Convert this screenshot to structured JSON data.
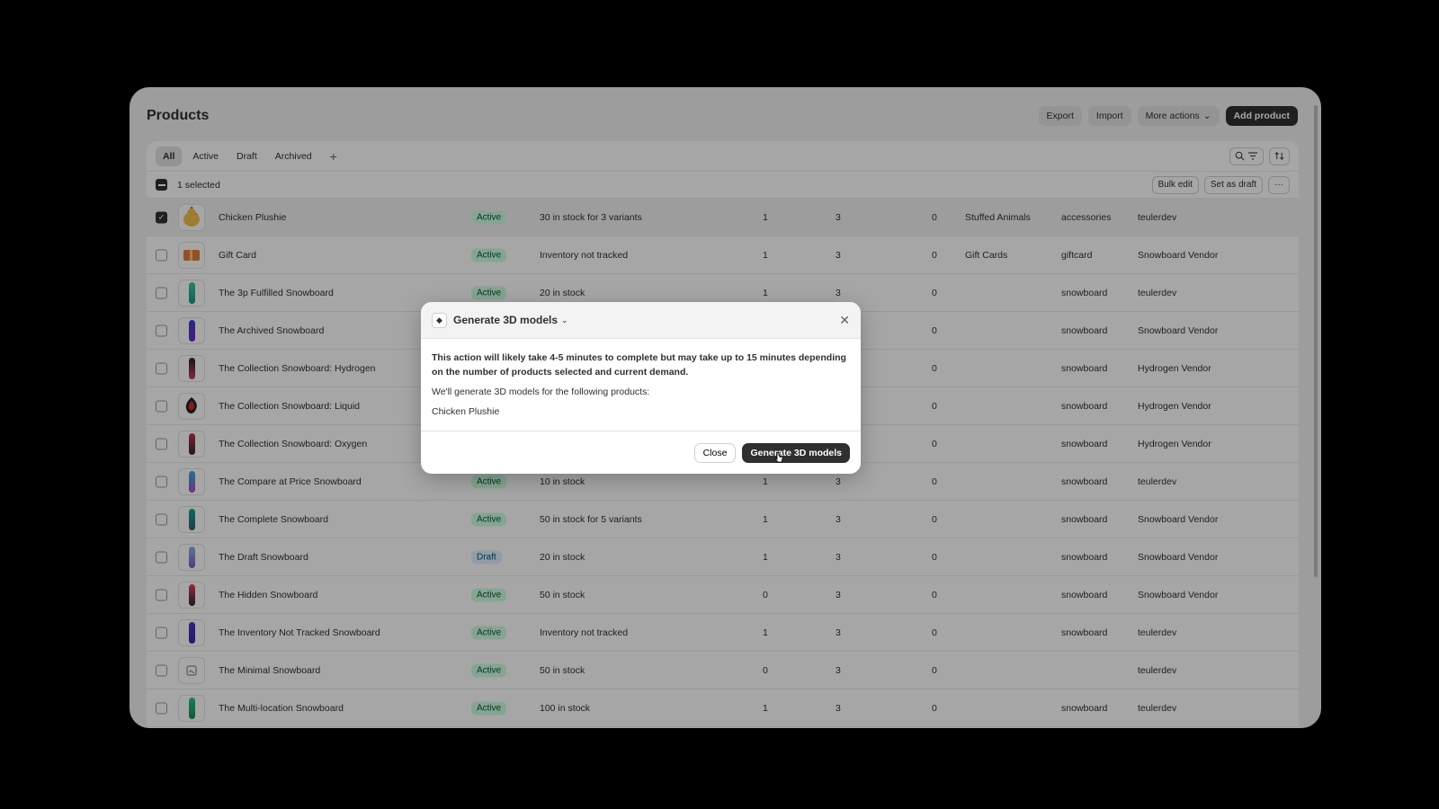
{
  "header": {
    "title": "Products",
    "export_label": "Export",
    "import_label": "Import",
    "more_actions_label": "More actions",
    "add_product_label": "Add product"
  },
  "tabs": [
    {
      "label": "All",
      "active": true
    },
    {
      "label": "Active",
      "active": false
    },
    {
      "label": "Draft",
      "active": false
    },
    {
      "label": "Archived",
      "active": false
    }
  ],
  "selection": {
    "text": "1 selected",
    "bulk_edit_label": "Bulk edit",
    "set_draft_label": "Set as draft"
  },
  "products": [
    {
      "name": "Chicken Plushie",
      "status": "Active",
      "inventory": "30 in stock for 3 variants",
      "n1": "1",
      "n2": "3",
      "n3": "0",
      "type": "Stuffed Animals",
      "category": "accessories",
      "vendor": "teulerdev",
      "checked": true,
      "thumb": "chicken",
      "colors": [
        "#f2c14e"
      ]
    },
    {
      "name": "Gift Card",
      "status": "Active",
      "inventory": "Inventory not tracked",
      "n1": "1",
      "n2": "3",
      "n3": "0",
      "type": "Gift Cards",
      "category": "giftcard",
      "vendor": "Snowboard Vendor",
      "checked": false,
      "thumb": "card",
      "colors": [
        "#e07b3a"
      ]
    },
    {
      "name": "The 3p Fulfilled Snowboard",
      "status": "Active",
      "inventory": "20 in stock",
      "n1": "1",
      "n2": "3",
      "n3": "0",
      "type": "",
      "category": "snowboard",
      "vendor": "teulerdev",
      "checked": false,
      "thumb": "board",
      "colors": [
        "#3ec9b0",
        "#1e8f80"
      ]
    },
    {
      "name": "The Archived Snowboard",
      "status": "",
      "inventory": "",
      "n1": "",
      "n2": "",
      "n3": "0",
      "type": "",
      "category": "snowboard",
      "vendor": "Snowboard Vendor",
      "checked": false,
      "thumb": "board",
      "colors": [
        "#3a3fd1",
        "#6a2bc2"
      ]
    },
    {
      "name": "The Collection Snowboard: Hydrogen",
      "status": "",
      "inventory": "",
      "n1": "",
      "n2": "",
      "n3": "0",
      "type": "",
      "category": "snowboard",
      "vendor": "Hydrogen Vendor",
      "checked": false,
      "thumb": "board",
      "colors": [
        "#222222",
        "#c73b6e"
      ]
    },
    {
      "name": "The Collection Snowboard: Liquid",
      "status": "",
      "inventory": "",
      "n1": "",
      "n2": "",
      "n3": "0",
      "type": "",
      "category": "snowboard",
      "vendor": "Hydrogen Vendor",
      "checked": false,
      "thumb": "liquid",
      "colors": [
        "#d42a2a",
        "#222222"
      ]
    },
    {
      "name": "The Collection Snowboard: Oxygen",
      "status": "",
      "inventory": "",
      "n1": "",
      "n2": "",
      "n3": "0",
      "type": "",
      "category": "snowboard",
      "vendor": "Hydrogen Vendor",
      "checked": false,
      "thumb": "board",
      "colors": [
        "#c7324f",
        "#2b2b2b"
      ]
    },
    {
      "name": "The Compare at Price Snowboard",
      "status": "Active",
      "inventory": "10 in stock",
      "n1": "1",
      "n2": "3",
      "n3": "0",
      "type": "",
      "category": "snowboard",
      "vendor": "teulerdev",
      "checked": false,
      "thumb": "board",
      "colors": [
        "#2bb3d9",
        "#b24ac9"
      ]
    },
    {
      "name": "The Complete Snowboard",
      "status": "Active",
      "inventory": "50 in stock for 5 variants",
      "n1": "1",
      "n2": "3",
      "n3": "0",
      "type": "",
      "category": "snowboard",
      "vendor": "Snowboard Vendor",
      "checked": false,
      "thumb": "board",
      "colors": [
        "#1fa08c",
        "#2d5c7a"
      ]
    },
    {
      "name": "The Draft Snowboard",
      "status": "Draft",
      "inventory": "20 in stock",
      "n1": "1",
      "n2": "3",
      "n3": "0",
      "type": "",
      "category": "snowboard",
      "vendor": "Snowboard Vendor",
      "checked": false,
      "thumb": "board",
      "colors": [
        "#8fb4e0",
        "#7a5cc9"
      ]
    },
    {
      "name": "The Hidden Snowboard",
      "status": "Active",
      "inventory": "50 in stock",
      "n1": "0",
      "n2": "3",
      "n3": "0",
      "type": "",
      "category": "snowboard",
      "vendor": "Snowboard Vendor",
      "checked": false,
      "thumb": "board",
      "colors": [
        "#e0405a",
        "#2b2b2b"
      ]
    },
    {
      "name": "The Inventory Not Tracked Snowboard",
      "status": "Active",
      "inventory": "Inventory not tracked",
      "n1": "1",
      "n2": "3",
      "n3": "0",
      "type": "",
      "category": "snowboard",
      "vendor": "teulerdev",
      "checked": false,
      "thumb": "board",
      "colors": [
        "#5a2bd1",
        "#2b2b9a"
      ]
    },
    {
      "name": "The Minimal Snowboard",
      "status": "Active",
      "inventory": "50 in stock",
      "n1": "0",
      "n2": "3",
      "n3": "0",
      "type": "",
      "category": "",
      "vendor": "teulerdev",
      "checked": false,
      "thumb": "placeholder",
      "colors": [
        "#8a8a8a"
      ]
    },
    {
      "name": "The Multi-location Snowboard",
      "status": "Active",
      "inventory": "100 in stock",
      "n1": "1",
      "n2": "3",
      "n3": "0",
      "type": "",
      "category": "snowboard",
      "vendor": "teulerdev",
      "checked": false,
      "thumb": "board",
      "colors": [
        "#2ec27a",
        "#1a8a5a"
      ]
    }
  ],
  "modal": {
    "title": "Generate 3D models",
    "body_strong": "This action will likely take 4-5 minutes to complete but may take up to 15 minutes depending on the number of products selected and current demand.",
    "body_intro": "We'll generate 3D models for the following products:",
    "product_list": "Chicken Plushie",
    "close_label": "Close",
    "generate_label": "Generate 3D models"
  }
}
